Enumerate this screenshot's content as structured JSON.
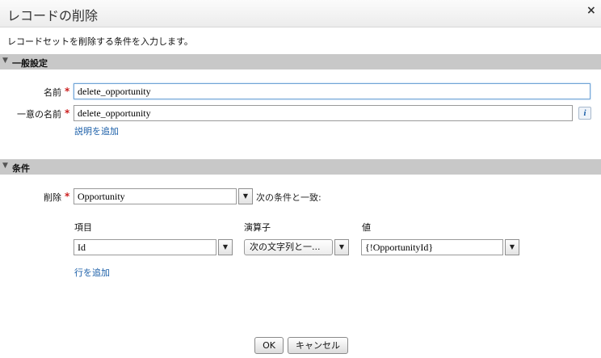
{
  "dialog": {
    "title": "レコードの削除",
    "close_symbol": "×",
    "description": "レコードセットを削除する条件を入力します。"
  },
  "general": {
    "header": "一般設定",
    "name_label": "名前",
    "name_value": "delete_opportunity",
    "unique_name_label": "一意の名前",
    "unique_name_value": "delete_opportunity",
    "required_mark": "*",
    "info_icon": "i",
    "add_description_link": "説明を追加"
  },
  "conditions": {
    "header": "条件",
    "delete_label": "削除",
    "object_value": "Opportunity",
    "match_text": "次の条件と一致:",
    "columns": {
      "field": "項目",
      "operator": "演算子",
      "value": "値"
    },
    "row": {
      "field": "Id",
      "operator": "次の文字列と一...",
      "value": "{!OpportunityId}"
    },
    "add_row_link": "行を追加"
  },
  "footer": {
    "ok_label": "OK",
    "cancel_label": "キャンセル"
  },
  "icons": {
    "collapse": "triangle-down-icon",
    "dropdown": "chevron-down-icon"
  }
}
